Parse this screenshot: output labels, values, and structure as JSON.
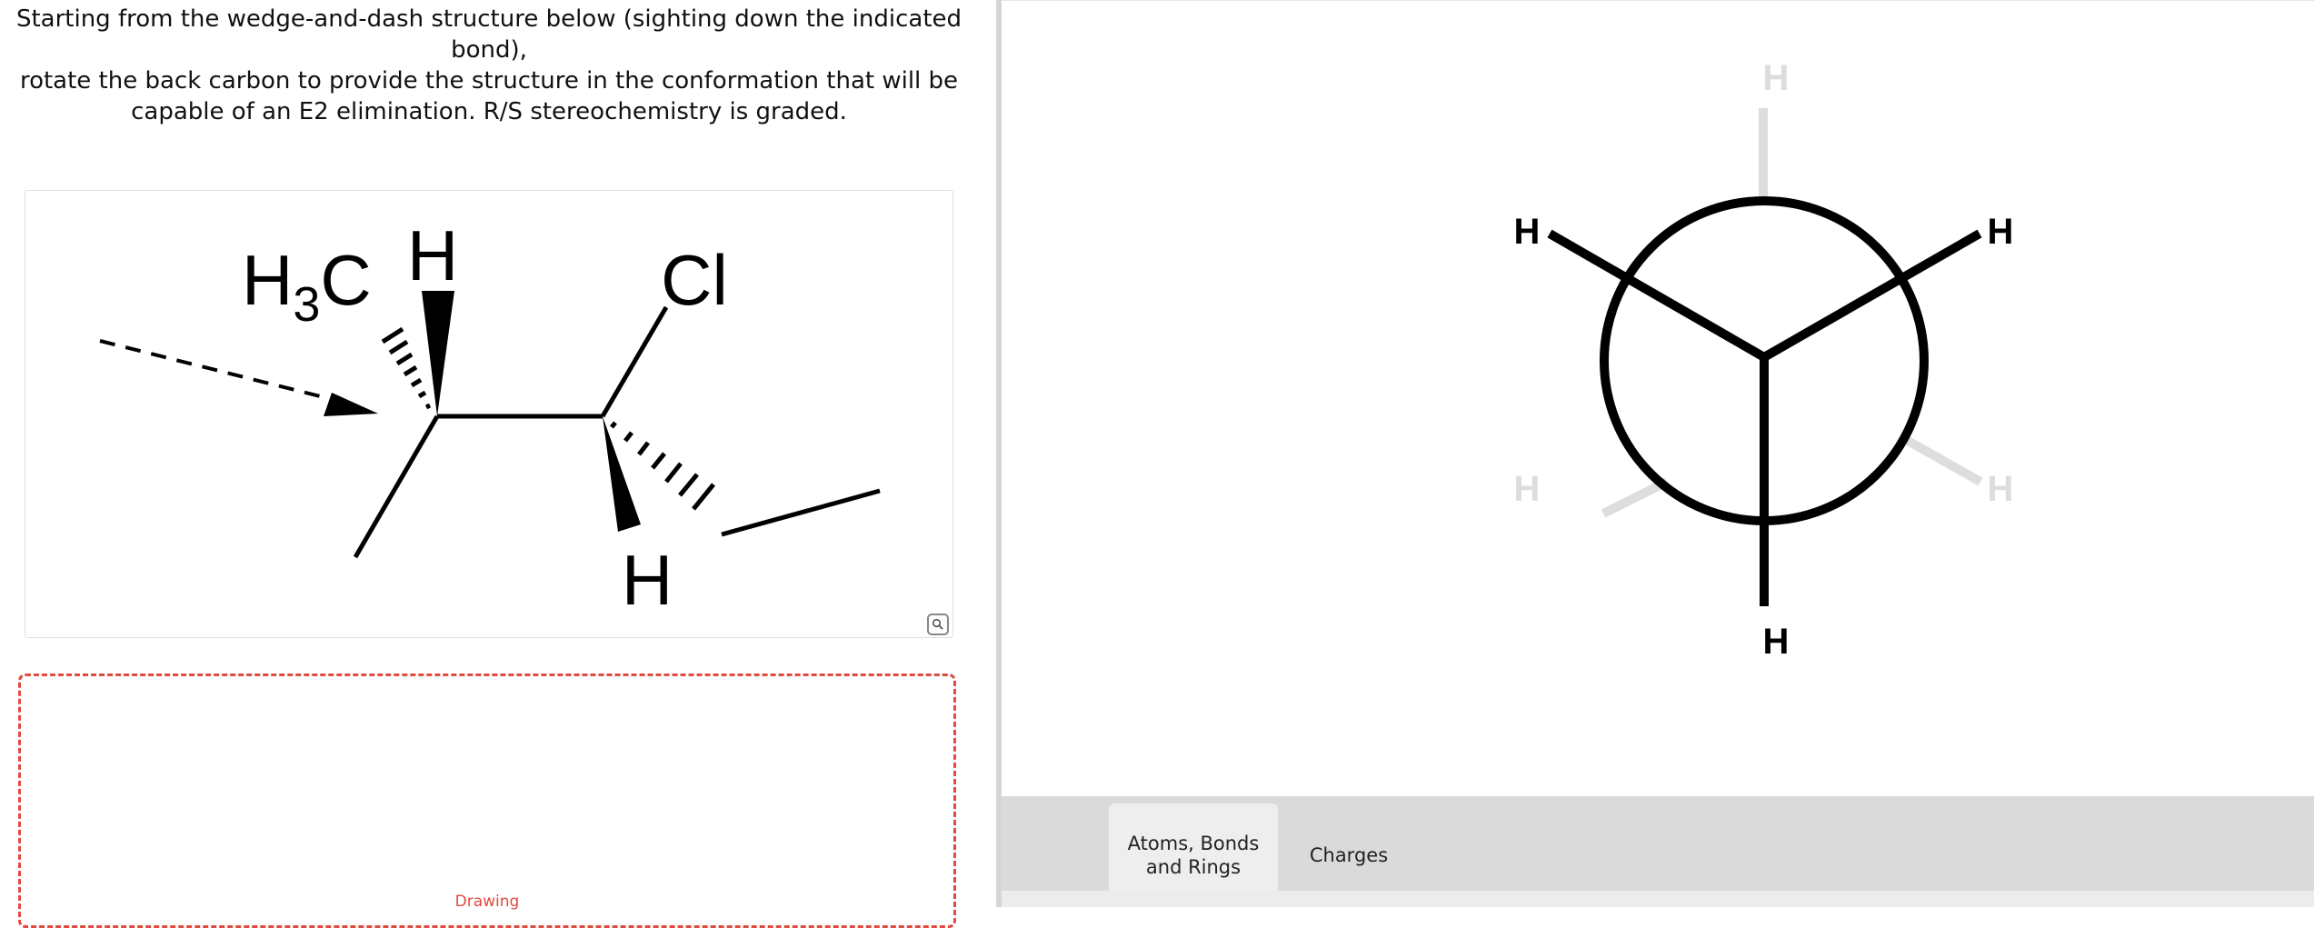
{
  "question": {
    "line1": "Starting from the wedge-and-dash structure below (sighting down the indicated bond),",
    "line2": "rotate the back carbon to provide the structure in the conformation that will be",
    "line3": "capable of an E2 elimination. R/S stereochemistry is graded."
  },
  "structure": {
    "h3c_main": "H",
    "h3c_sub": "3",
    "h3c_c": "C",
    "h_top": "H",
    "cl": "Cl",
    "h_bottom": "H"
  },
  "drawing": {
    "label": "Drawing"
  },
  "newman": {
    "front_h_left": "H",
    "front_h_right": "H",
    "front_h_bottom": "H",
    "back_h_top": "H",
    "back_h_left": "H",
    "back_h_right": "H",
    "colors": {
      "front": "#000000",
      "back": "#dddddd"
    }
  },
  "toolbar": {
    "tab_atoms": "Atoms, Bonds\nand Rings",
    "tab_charges": "Charges"
  },
  "icons": {
    "zoom": "magnifier-icon"
  }
}
